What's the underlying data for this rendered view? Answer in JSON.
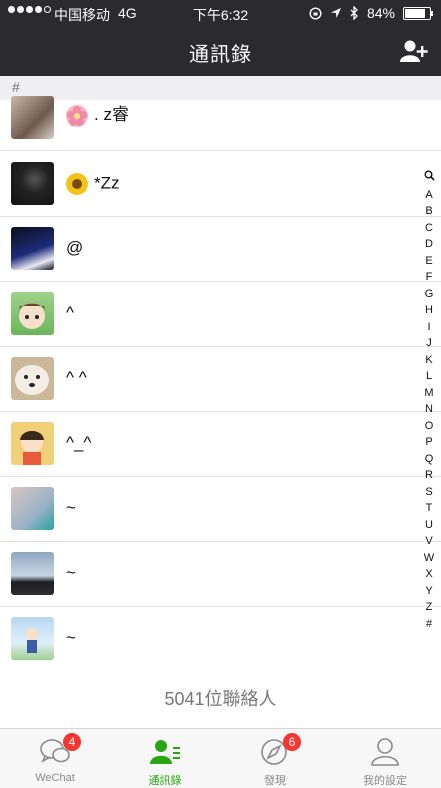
{
  "status_bar": {
    "carrier": "中国移动",
    "network": "4G",
    "time": "下午6:32",
    "battery": "84%",
    "battery_level": 0.84
  },
  "nav": {
    "title": "通訊錄",
    "add_icon": "add-contact-icon"
  },
  "section_header": "#",
  "contacts": [
    {
      "prefix_icon": "flower-icon",
      "name": ". z睿"
    },
    {
      "prefix_icon": "sunflower-icon",
      "name": "*Zz"
    },
    {
      "prefix_icon": "",
      "name": "@"
    },
    {
      "prefix_icon": "",
      "name": "^"
    },
    {
      "prefix_icon": "",
      "name": "^ ^"
    },
    {
      "prefix_icon": "",
      "name": "^_^"
    },
    {
      "prefix_icon": "",
      "name": "~"
    },
    {
      "prefix_icon": "",
      "name": "~"
    },
    {
      "prefix_icon": "",
      "name": "~"
    }
  ],
  "index_letters": [
    "A",
    "B",
    "C",
    "D",
    "E",
    "F",
    "G",
    "H",
    "I",
    "J",
    "K",
    "L",
    "M",
    "N",
    "O",
    "P",
    "Q",
    "R",
    "S",
    "T",
    "U",
    "V",
    "W",
    "X",
    "Y",
    "Z",
    "#"
  ],
  "contact_count": "5041位聯絡人",
  "tabs": [
    {
      "label": "WeChat",
      "badge": "4",
      "icon": "chat-bubbles-icon"
    },
    {
      "label": "通訊錄",
      "badge": "",
      "icon": "contacts-icon"
    },
    {
      "label": "發現",
      "badge": "6",
      "icon": "compass-icon"
    },
    {
      "label": "我的設定",
      "badge": "",
      "icon": "profile-icon"
    }
  ],
  "colors": {
    "bar_dark": "#2b2b2f",
    "accent_green": "#2aa515",
    "badge_red": "#f43530"
  }
}
